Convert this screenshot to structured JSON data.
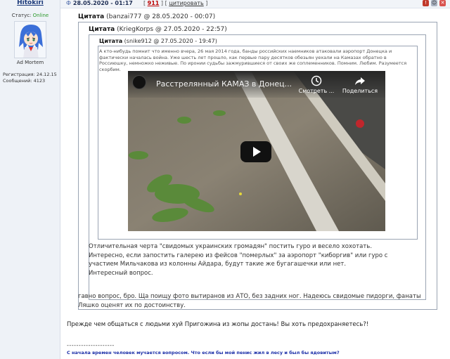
{
  "user": {
    "name": "Hitokiri",
    "status_label": "Статус:",
    "status_value": "Online",
    "avatar_caption": "Ad Mortem",
    "registration": "Регистрация: 24.12.15",
    "messages": "Сообщений: 4123"
  },
  "post": {
    "icon": "Ф",
    "date": "28.05.2020 - 01:17",
    "count_open": "[",
    "count": "911",
    "count_mid": "] [",
    "quote_link": "цитировать",
    "count_close": "]",
    "text": "Прежде чем общаться с людьми хуй Пригожина из жопы достань! Вы хоть предохраняетесь?!",
    "signature_separator": "--------------------",
    "signature": "С начала времен человек мучается вопросом. Что если бы мой пенис жил в лесу и был бы ядовитым?"
  },
  "quotes": {
    "q1": {
      "label": "Цитата",
      "meta": "(banzai777 @ 28.05.2020 - 00:07)",
      "text": "гавно вопрос, бро. Ща поищу фото вытиранов из АТО, без задних ног. Надеюсь свидомые пидорги, фанаты Ляшко оценят их по достоинству."
    },
    "q2": {
      "label": "Цитата",
      "meta": "(KriegKorps @ 27.05.2020 - 22:57)",
      "lines": [
        "Отличительная черта \"свидомых украинских громадян\" постить гуро и весело хохотать.",
        "Интересно, если запостить галерею из фейсов \"померлых\" за аэропорт \"киборгив\" или гуро с участием Мильчакова из колонны Айдара, будут такие же бугагашечки или нет.",
        "Интересный вопрос."
      ]
    },
    "q3": {
      "label": "Цитата",
      "meta": "(snike912 @ 27.05.2020 - 19:47)",
      "text": "А кто-нибудь помнит что именно вчера, 26 мая 2014 года, банды российских наемников атаковали аэропорт Донецка и фактически началась война. Уже шесть лет прошло, как первые пару десятков обезьян уехали на Камазах обратно в Россиюшку, немножко неживые. По иронии судьбы зажмурившиеся от своих же соплеменников. Помним. Любим. Разумеется скорбим."
    }
  },
  "video": {
    "title": "Расстрелянный КАМАЗ в Донец...",
    "watch_later": "Смотреть ...",
    "share": "Поделиться"
  }
}
